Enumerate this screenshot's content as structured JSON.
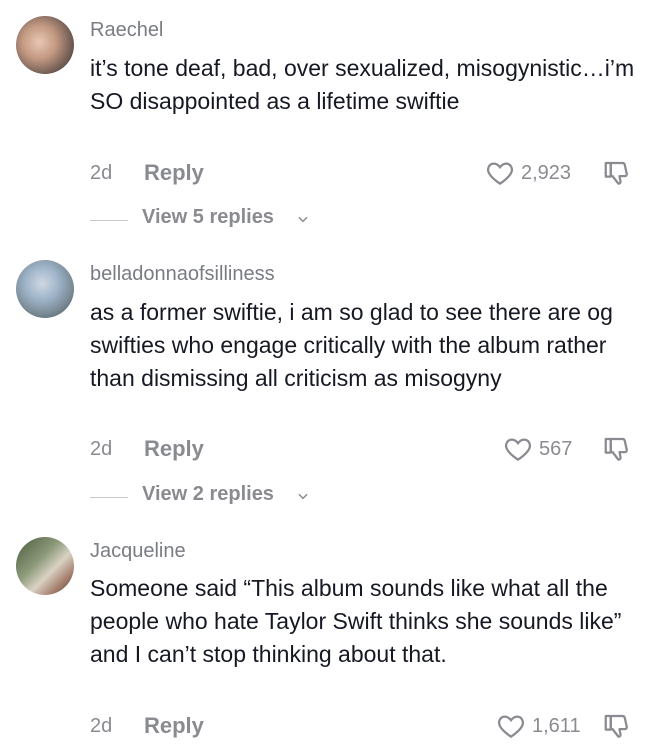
{
  "comments": [
    {
      "username": "Raechel",
      "text": "it’s tone deaf, bad, over sexualized, misogynistic…i’m SO disappointed as a lifetime swiftie",
      "time": "2d",
      "reply_label": "Reply",
      "likes": "2,923",
      "view_replies": "View 5 replies"
    },
    {
      "username": "belladonnaofsilliness",
      "text": "as a former swiftie, i am so glad to see there are og swifties who engage critically with the album rather than dismissing all criticism as misogyny",
      "time": "2d",
      "reply_label": "Reply",
      "likes": "567",
      "view_replies": "View 2 replies"
    },
    {
      "username": "Jacqueline",
      "text": "Someone said “This album sounds like what all the people who hate Taylor Swift thinks she sounds like” and I can’t stop thinking about that.",
      "time": "2d",
      "reply_label": "Reply",
      "likes": "1,611"
    }
  ],
  "icons": {
    "like": "heart-outline-icon",
    "dislike": "thumbs-down-outline-icon",
    "expand": "chevron-down-icon"
  },
  "colors": {
    "text_primary": "#161823",
    "text_secondary": "#8a8b91"
  }
}
